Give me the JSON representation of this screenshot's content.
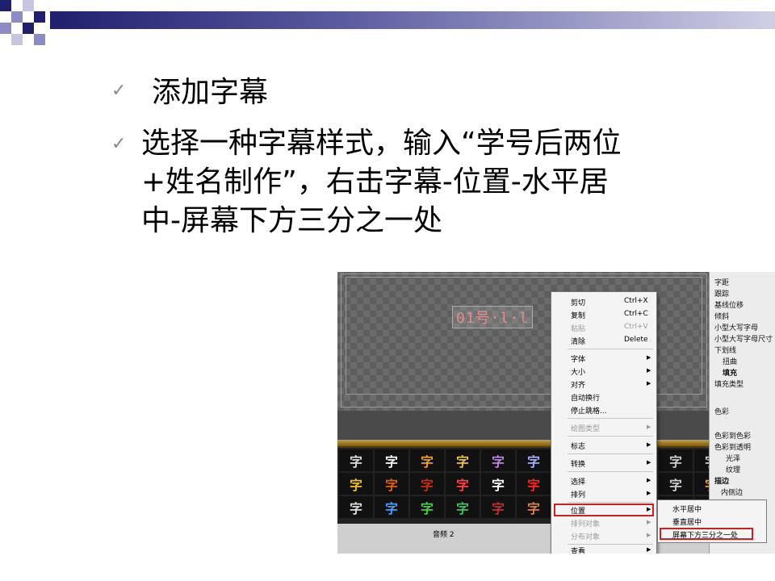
{
  "slide": {
    "bullets": [
      {
        "lines": [
          "添加字幕"
        ]
      },
      {
        "lines": [
          "选择一种字幕样式，输入“学号后两位",
          "+姓名制作”，右击字幕-位置-水平居",
          "中-屏幕下方三分之一处"
        ]
      }
    ],
    "bullet_mark": "✓"
  },
  "screenshot": {
    "caption_text": "01号·l·l",
    "context_menu": {
      "items": [
        {
          "label": "剪切",
          "shortcut": "Ctrl+X"
        },
        {
          "label": "复制",
          "shortcut": "Ctrl+C"
        },
        {
          "label": "粘贴",
          "shortcut": "Ctrl+V"
        },
        {
          "label": "清除",
          "shortcut": "Delete"
        },
        {
          "label": "字体"
        },
        {
          "label": "大小"
        },
        {
          "label": "对齐"
        },
        {
          "label": "自动换行"
        },
        {
          "label": "停止跳格..."
        },
        {
          "label": "绘图类型"
        },
        {
          "label": "标志"
        },
        {
          "label": "转换"
        },
        {
          "label": "选择"
        },
        {
          "label": "排列"
        },
        {
          "label": "位置"
        },
        {
          "label": "排列对象"
        },
        {
          "label": "分布对象"
        },
        {
          "label": "查看"
        }
      ]
    },
    "position_submenu": {
      "items": [
        "水平居中",
        "垂直居中",
        "屏幕下方三分之一处"
      ]
    },
    "properties_panel": {
      "items": [
        "字距",
        "跟踪",
        "基线位移",
        "倾斜",
        "小型大写字母",
        "小型大写字母尺寸",
        "下划线",
        "扭曲",
        "填充",
        "填充类型",
        "色彩",
        "色彩到色彩",
        "色彩到透明",
        "光泽",
        "纹理",
        "描边",
        "内侧边"
      ]
    },
    "timeline": {
      "track_label": "音频 2"
    },
    "style_glyphs": [
      "字",
      "字",
      "字",
      "字",
      "字",
      "字",
      "字",
      "字",
      "字",
      "字",
      "字"
    ]
  }
}
